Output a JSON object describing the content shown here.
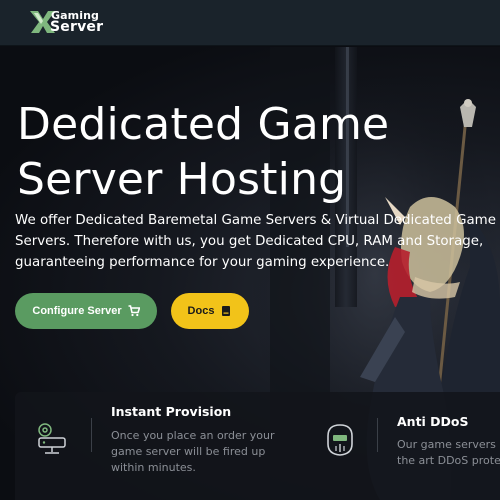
{
  "nav": {
    "logo_gaming": "Gaming",
    "logo_server": "Server"
  },
  "hero": {
    "title_line1": "Dedicated Game",
    "title_line2": "Server Hosting",
    "desc_line1": "We offer Dedicated Baremetal Game Servers & Virtual Dedicated Game",
    "desc_line2": "Servers. Therefore with us, you get Dedicated CPU, RAM and Storage,",
    "desc_line3": "guaranteeing performance for your gaming experience.",
    "configure_label": "Configure Server",
    "docs_label": "Docs"
  },
  "features": [
    {
      "title": "Instant Provision",
      "lines": [
        "Once you place an order your",
        "game server will be fired up",
        "within minutes."
      ],
      "icon": "server-provision-icon"
    },
    {
      "title": "Anti DDoS",
      "lines": [
        "Our game servers hav",
        "the art DDoS protectio"
      ],
      "icon": "shield-helmet-icon"
    }
  ],
  "colors": {
    "accent_green": "#5a9b61",
    "accent_yellow": "#f2c319",
    "navbar_bg": "#1a232b"
  }
}
